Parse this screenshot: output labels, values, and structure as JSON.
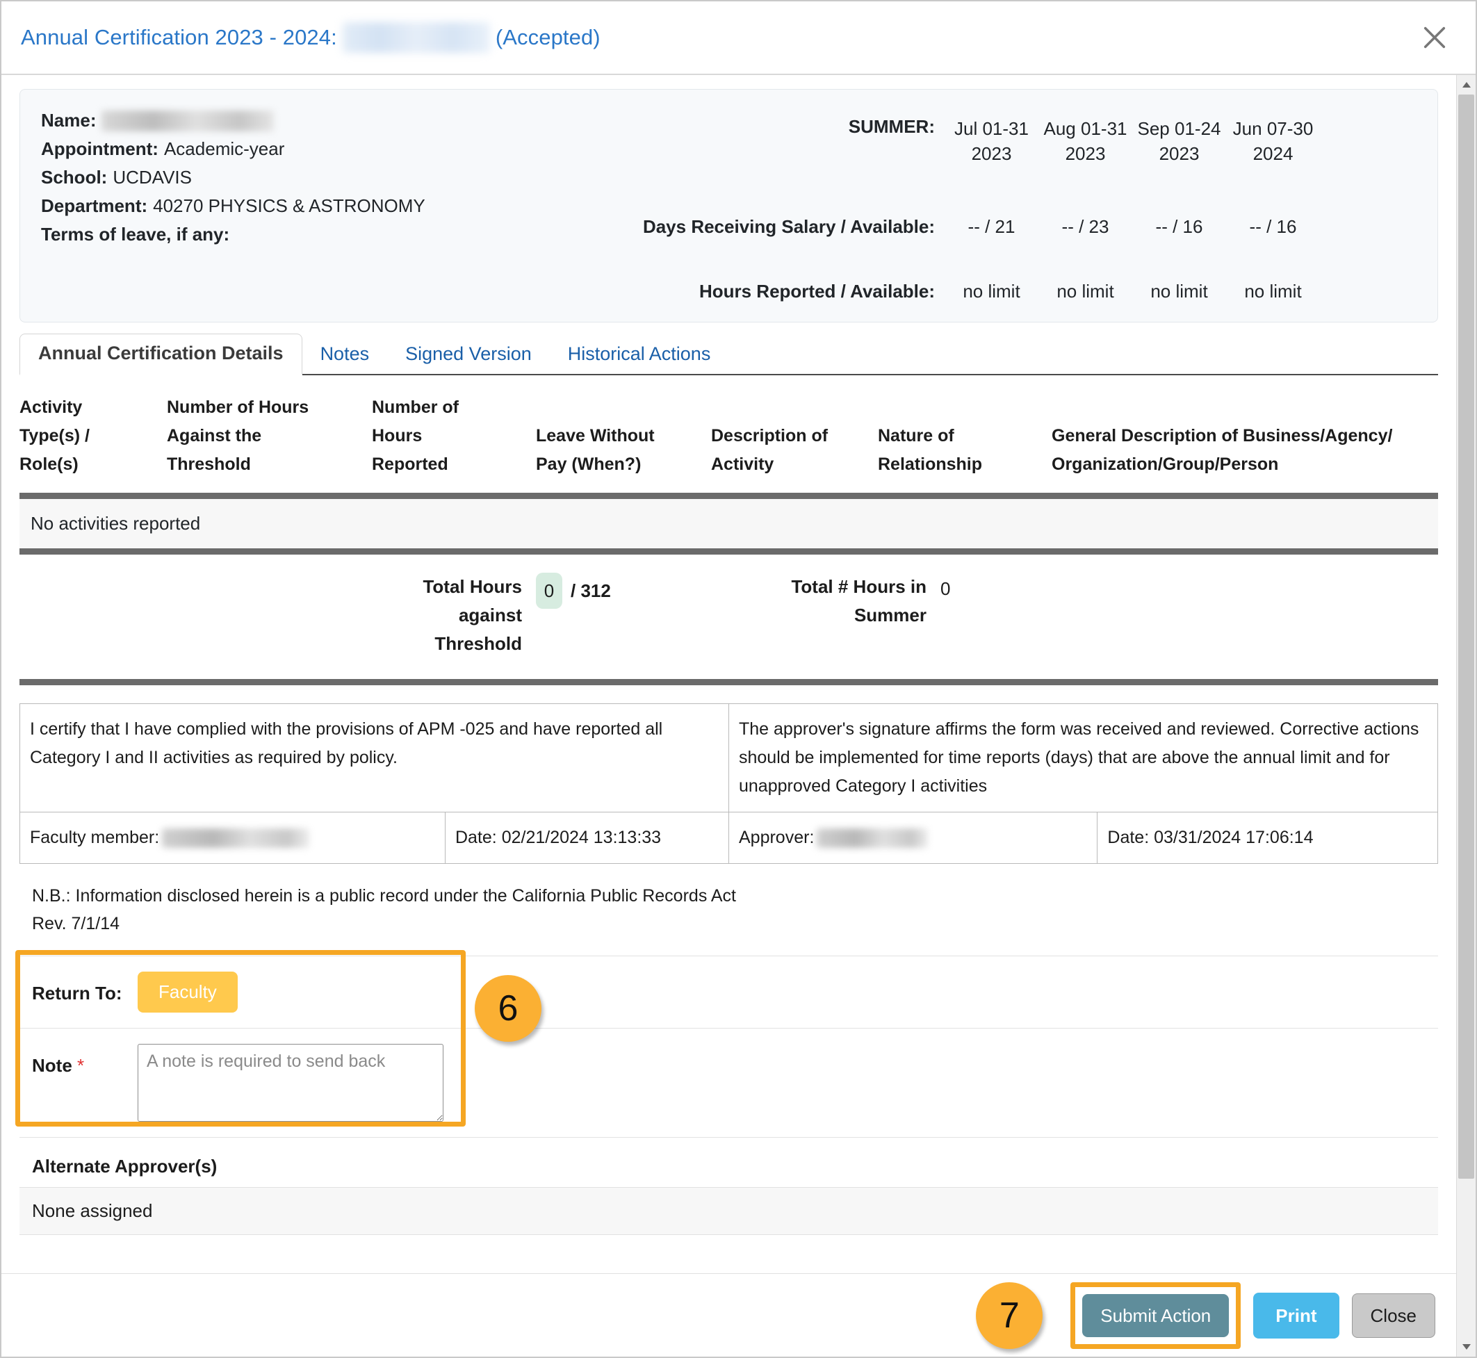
{
  "header": {
    "title_prefix": "Annual Certification 2023 - 2024:",
    "status": "(Accepted)",
    "close_icon": "close-icon"
  },
  "info": {
    "labels": {
      "name": "Name:",
      "appointment": "Appointment:",
      "school": "School:",
      "department": "Department:",
      "terms": "Terms of leave, if any:"
    },
    "values": {
      "name": "",
      "appointment": "Academic-year",
      "school": "UCDAVIS",
      "department": "40270 PHYSICS & ASTRONOMY",
      "terms": ""
    },
    "summer": {
      "label": "SUMMER:",
      "days_label": "Days Receiving Salary / Available:",
      "hours_label": "Hours Reported / Available:",
      "periods": [
        {
          "range": "Jul 01-31",
          "year": "2023",
          "days": "-- / 21",
          "hours": "no limit"
        },
        {
          "range": "Aug 01-31",
          "year": "2023",
          "days": "-- / 23",
          "hours": "no limit"
        },
        {
          "range": "Sep 01-24",
          "year": "2023",
          "days": "-- / 16",
          "hours": "no limit"
        },
        {
          "range": "Jun 07-30",
          "year": "2024",
          "days": "-- / 16",
          "hours": "no limit"
        }
      ]
    }
  },
  "tabs": [
    {
      "label": "Annual Certification Details",
      "active": true
    },
    {
      "label": "Notes",
      "active": false
    },
    {
      "label": "Signed Version",
      "active": false
    },
    {
      "label": "Historical Actions",
      "active": false
    }
  ],
  "activity_table": {
    "headers": [
      "Activity Type(s) / Role(s)",
      "Number of Hours Against the Threshold",
      "Number of Hours Reported",
      "Leave Without Pay (When?)",
      "Description of Activity",
      "Nature of Relationship",
      "General Description of Business/Agency/ Organization/Group/Person"
    ],
    "headers_lines": {
      "h1": [
        "Activity",
        "Type(s) /",
        "Role(s)"
      ],
      "h2": [
        "Number of Hours",
        "Against the",
        "Threshold"
      ],
      "h3": [
        "Number of",
        "Hours",
        "Reported"
      ],
      "h4": [
        "Leave Without",
        "Pay (When?)"
      ],
      "h5": [
        "Description of",
        "Activity"
      ],
      "h6": [
        "Nature of",
        "Relationship"
      ],
      "h7": [
        "General Description of Business/Agency/",
        "Organization/Group/Person"
      ]
    },
    "empty_message": "No activities reported",
    "totals": {
      "threshold_label_lines": [
        "Total Hours",
        "against",
        "Threshold"
      ],
      "threshold_value": "0",
      "threshold_limit": "/ 312",
      "summer_label_lines": [
        "Total # Hours in",
        "Summer"
      ],
      "summer_value": "0"
    }
  },
  "certification": {
    "faculty_statement": "I certify that I have complied with the provisions of APM -025 and have reported all Category I and II activities as required by policy.",
    "approver_statement": "The approver's signature affirms the form was received and reviewed. Corrective actions should be implemented for time reports (days) that are above the annual limit and for unapproved Category I activities",
    "faculty_member_label": "Faculty member:",
    "faculty_date": "Date: 02/21/2024 13:13:33",
    "approver_label": "Approver:",
    "approver_date": "Date: 03/31/2024 17:06:14"
  },
  "notice": {
    "line1": "N.B.: Information disclosed herein is a public record under the California Public Records Act",
    "line2": "Rev. 7/1/14"
  },
  "return_to": {
    "label": "Return To:",
    "button_label": "Faculty",
    "note_label": "Note",
    "required_mark": "*",
    "note_value": "",
    "note_placeholder": "A note is required to send back",
    "callout_number": "6"
  },
  "alternate_approvers": {
    "title": "Alternate Approver(s)",
    "value": "None assigned"
  },
  "footer": {
    "callout_number": "7",
    "submit_label": "Submit Action",
    "print_label": "Print",
    "close_label": "Close"
  },
  "colors": {
    "link_blue": "#2a77c8",
    "tab_blue": "#1a5fa8",
    "highlight_orange": "#f5a623",
    "callout_orange": "#fbb033",
    "faculty_button": "#ffc94d",
    "submit_button": "#5f8d9b",
    "print_button": "#49b9ea",
    "close_button": "#c9c9c9",
    "pill_green": "#d7ece0",
    "required_red": "#e03131"
  }
}
